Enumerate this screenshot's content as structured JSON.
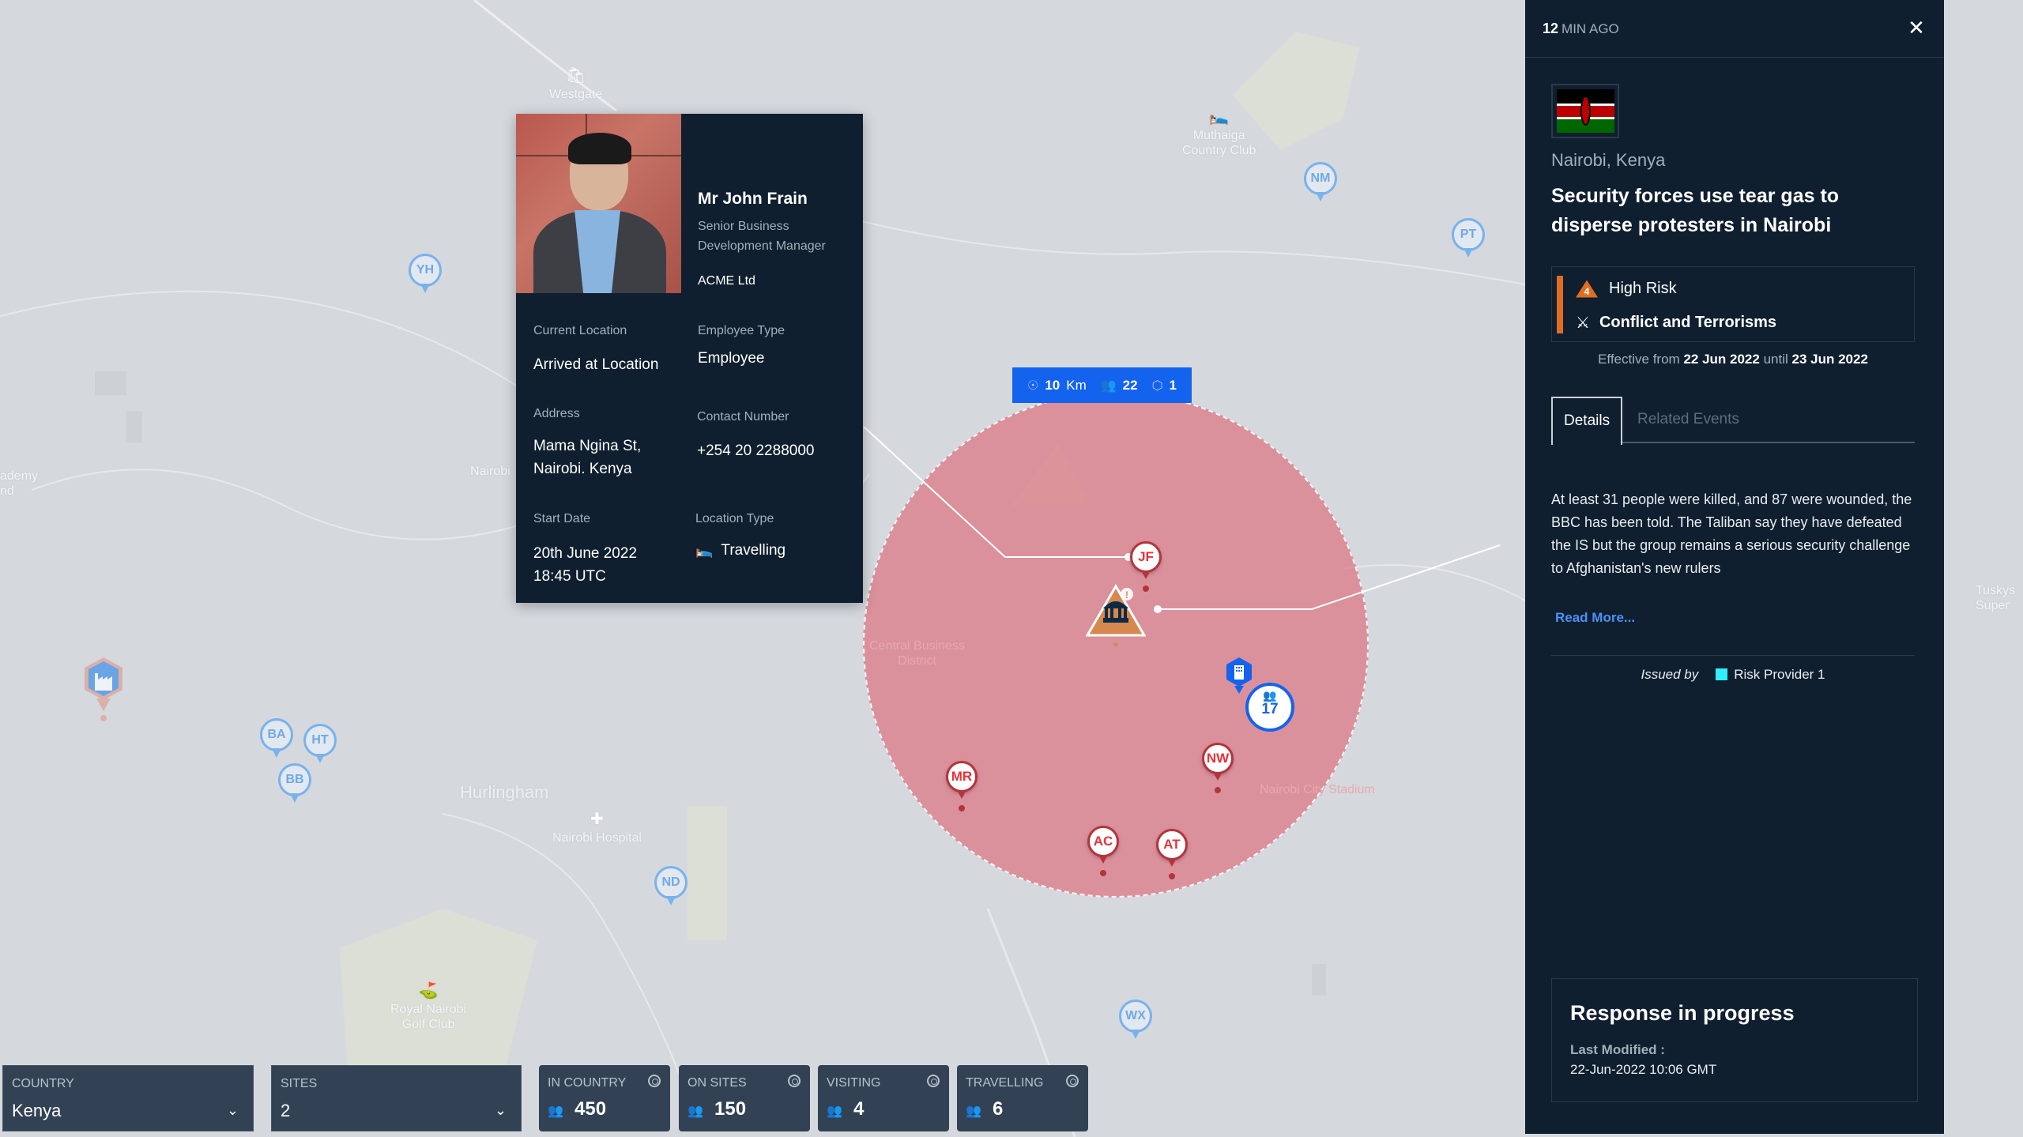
{
  "map": {
    "labels": {
      "westgate": "Westgate",
      "muthaiga": "Muthaiga\nCountry Club",
      "academy": "ademy\nnd",
      "nairobi": "Nairobi",
      "hurlingham": "Hurlingham",
      "hospital": "Nairobi Hospital",
      "golf": "Royal Nairobi\nGolf Club",
      "cbd": "Central Business\nDistrict",
      "stadium": "Nairobi City Stadium",
      "tuskys": "Tuskys\nSuper"
    },
    "blue_pins": [
      "YH",
      "NM",
      "PT",
      "BA",
      "HT",
      "BB",
      "ND",
      "WX"
    ],
    "red_pins": [
      "JF",
      "MR",
      "NW",
      "AC",
      "AT"
    ],
    "cluster_count": "17",
    "radius_badge": {
      "distance_value": "10",
      "distance_unit": "Km",
      "people": "22",
      "sites": "1"
    },
    "colors": {
      "radius_fill": "#dc6e7c",
      "badge": "#1463ef",
      "risk_orange": "#e06e22"
    }
  },
  "employee": {
    "name": "Mr John Frain",
    "title": "Senior Business Development Manager",
    "company": "ACME Ltd",
    "current_location_label": "Current Location",
    "current_location": "Arrived at Location",
    "employee_type_label": "Employee Type",
    "employee_type": "Employee",
    "address_label": "Address",
    "address": "Mama Ngina St,\nNairobi. Kenya",
    "contact_label": "Contact Number",
    "contact": "+254 20 2288000",
    "start_date_label": "Start Date",
    "start_date": "20th June 2022\n18:45 UTC",
    "location_type_label": "Location Type",
    "location_type": "Travelling"
  },
  "panel": {
    "time_value": "12",
    "time_unit": "MIN AGO",
    "location": "Nairobi, Kenya",
    "title": "Security forces use tear gas to disperse protesters in Nairobi",
    "risk_level_number": "4",
    "risk_level": "High Risk",
    "risk_category": "Conflict and Terrorisms",
    "effective_prefix": "Effective from",
    "effective_from": "22 Jun 2022",
    "effective_mid": "until",
    "effective_until": "23 Jun 2022",
    "tabs": [
      {
        "label": "Details",
        "active": true
      },
      {
        "label": "Related Events",
        "active": false
      }
    ],
    "details": "At least 31 people were killed, and 87 were wounded, the BBC has been told. The Taliban say they have defeated the IS but the group remains a serious security challenge to Afghanistan's new rulers",
    "read_more": "Read More...",
    "issued_by_label": "Issued by",
    "issued_by": "Risk Provider 1",
    "response_title": "Response in progress",
    "last_modified_label": "Last Modified :",
    "last_modified": "22-Jun-2022 10:06 GMT"
  },
  "bottom_bar": {
    "country": {
      "label": "COUNTRY",
      "value": "Kenya"
    },
    "sites": {
      "label": "SITES",
      "value": "2"
    },
    "stats": [
      {
        "label": "IN COUNTRY",
        "value": "450"
      },
      {
        "label": "ON SITES",
        "value": "150"
      },
      {
        "label": "VISITING",
        "value": "4"
      },
      {
        "label": "TRAVELLING",
        "value": "6"
      }
    ]
  }
}
